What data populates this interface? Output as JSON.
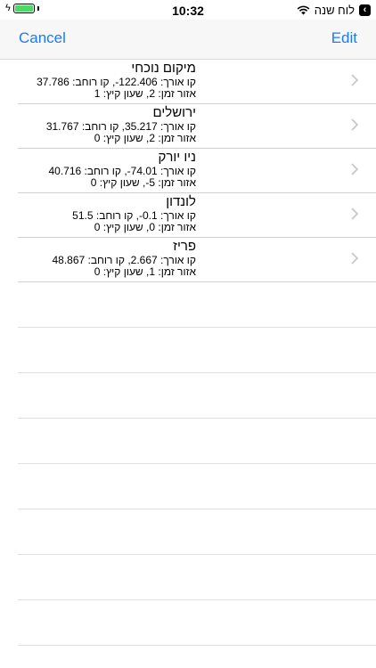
{
  "status_bar": {
    "time": "10:32",
    "back_app_label": "לוח שנה",
    "back_icon": "chevron-left-badge",
    "battery_color": "#4cd964",
    "wifi_icon": "wifi-icon"
  },
  "nav": {
    "cancel_label": "Cancel",
    "edit_label": "Edit",
    "accent_color": "#1a7cf5"
  },
  "locations": [
    {
      "name": "מיקום נוכחי",
      "coords": "קו אורך: 122.406-, קו רוחב: 37.786",
      "zone": "אזור זמן: 2, שעון קיץ: 1"
    },
    {
      "name": "ירושלים",
      "coords": "קו אורך: 35.217, קו רוחב: 31.767",
      "zone": "אזור זמן: 2, שעון קיץ: 0"
    },
    {
      "name": "ניו יורק",
      "coords": "קו אורך: 74.01-, קו רוחב: 40.716",
      "zone": "אזור זמן: 5-, שעון קיץ: 0"
    },
    {
      "name": "לונדון",
      "coords": "קו אורך: 0.1-, קו רוחב: 51.5",
      "zone": "אזור זמן: 0, שעון קיץ: 0"
    },
    {
      "name": "פריז",
      "coords": "קו אורך: 2.667, קו רוחב: 48.867",
      "zone": "אזור זמן: 1, שעון קיץ: 0"
    }
  ]
}
